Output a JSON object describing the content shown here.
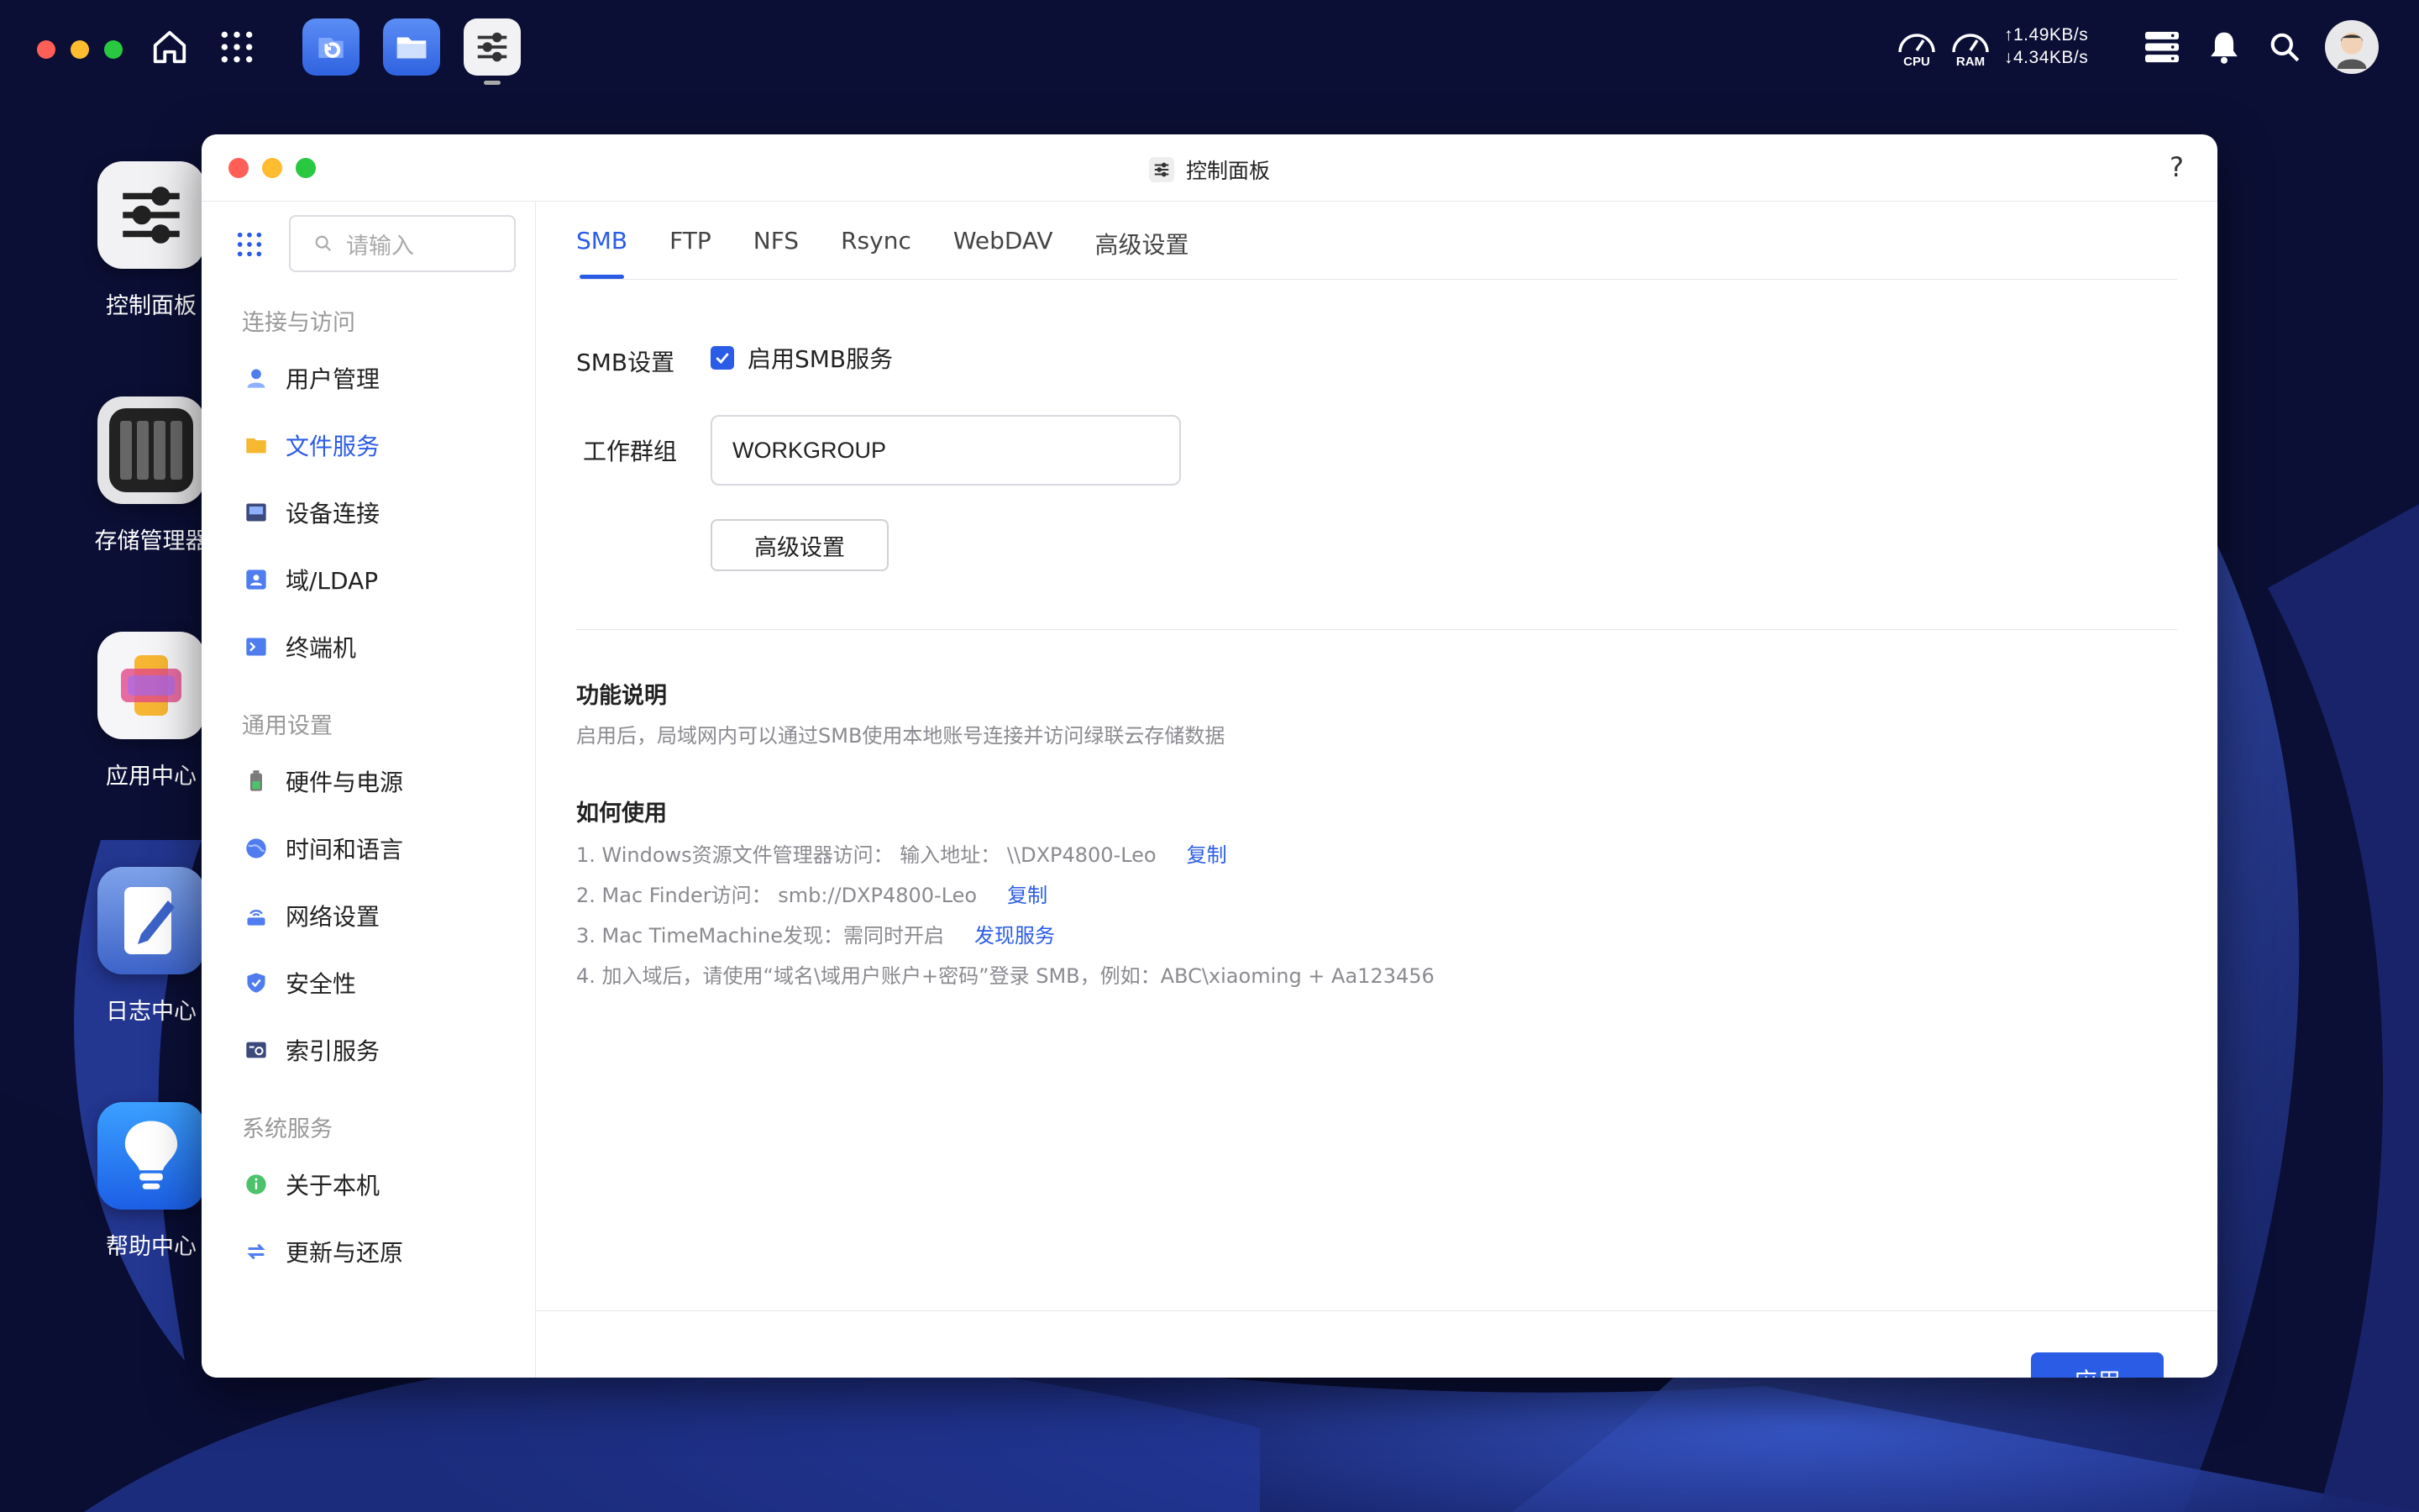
{
  "topbar": {
    "cpu_label": "CPU",
    "ram_label": "RAM",
    "upload": "↑1.49KB/s",
    "download": "↓4.34KB/s"
  },
  "desktop": {
    "icons": [
      {
        "label": "控制面板"
      },
      {
        "label": "存储管理器"
      },
      {
        "label": "应用中心"
      },
      {
        "label": "日志中心"
      },
      {
        "label": "帮助中心"
      }
    ]
  },
  "window": {
    "title": "控制面板",
    "help": "?"
  },
  "sidebar": {
    "search_placeholder": "请输入",
    "sections": [
      {
        "title": "连接与访问",
        "items": [
          "用户管理",
          "文件服务",
          "设备连接",
          "域/LDAP",
          "终端机"
        ]
      },
      {
        "title": "通用设置",
        "items": [
          "硬件与电源",
          "时间和语言",
          "网络设置",
          "安全性",
          "索引服务"
        ]
      },
      {
        "title": "系统服务",
        "items": [
          "关于本机",
          "更新与还原"
        ]
      }
    ],
    "active_item": "文件服务"
  },
  "tabs": [
    "SMB",
    "FTP",
    "NFS",
    "Rsync",
    "WebDAV",
    "高级设置"
  ],
  "active_tab": "SMB",
  "smb": {
    "settings_label": "SMB设置",
    "enable_label": "启用SMB服务",
    "enabled": true,
    "workgroup_label": "工作群组",
    "workgroup_value": "WORKGROUP",
    "advanced_button": "高级设置"
  },
  "info": {
    "func_title": "功能说明",
    "func_desc": "启用后，局域网内可以通过SMB使用本地账号连接并访问绿联云存储数据",
    "usage_title": "如何使用",
    "line1": "1. Windows资源文件管理器访问：  输入地址：  \\\\DXP4800-Leo",
    "line1_link": "复制",
    "line2": "2. Mac Finder访问：  smb://DXP4800-Leo",
    "line2_link": "复制",
    "line3": "3. Mac TimeMachine发现：需同时开启",
    "line3_link": "发现服务",
    "line4": "4. 加入域后，请使用“域名\\域用户账户+密码”登录 SMB，例如：ABC\\xiaoming + Aa123456"
  },
  "footer": {
    "apply": "应用"
  },
  "colors": {
    "accent": "#2a5ce6",
    "desktop_bg": "#0b0f35"
  }
}
